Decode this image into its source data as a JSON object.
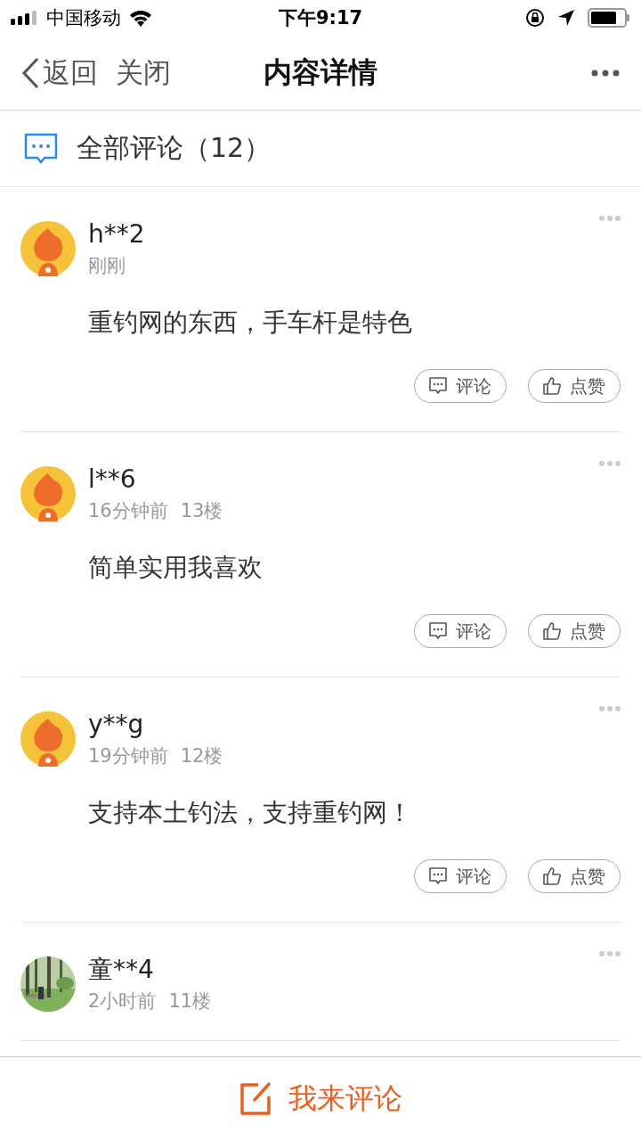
{
  "status_bar": {
    "carrier": "中国移动",
    "time": "下午9:17"
  },
  "nav": {
    "back": "返回",
    "close": "关闭",
    "title": "内容详情"
  },
  "section": {
    "title": "全部评论（12）"
  },
  "comments": [
    {
      "user": "h**2",
      "avatar": {
        "kind": "mascot"
      },
      "meta": [
        "刚刚"
      ],
      "text": "重钓网的东西，手车杆是特色",
      "actions": [
        "评论",
        "点赞"
      ]
    },
    {
      "user": "l**6",
      "avatar": {
        "kind": "mascot"
      },
      "meta": [
        "16分钟前",
        "13楼"
      ],
      "text": "简单实用我喜欢",
      "actions": [
        "评论",
        "点赞"
      ]
    },
    {
      "user": "y**g",
      "avatar": {
        "kind": "mascot"
      },
      "meta": [
        "19分钟前",
        "12楼"
      ],
      "text": "支持本土钓法，支持重钓网！",
      "actions": [
        "评论",
        "点赞"
      ]
    },
    {
      "user": "童**4",
      "meta": [
        "2小时前",
        "11楼"
      ]
    }
  ],
  "bottom_bar": {
    "label": "我来评论"
  }
}
